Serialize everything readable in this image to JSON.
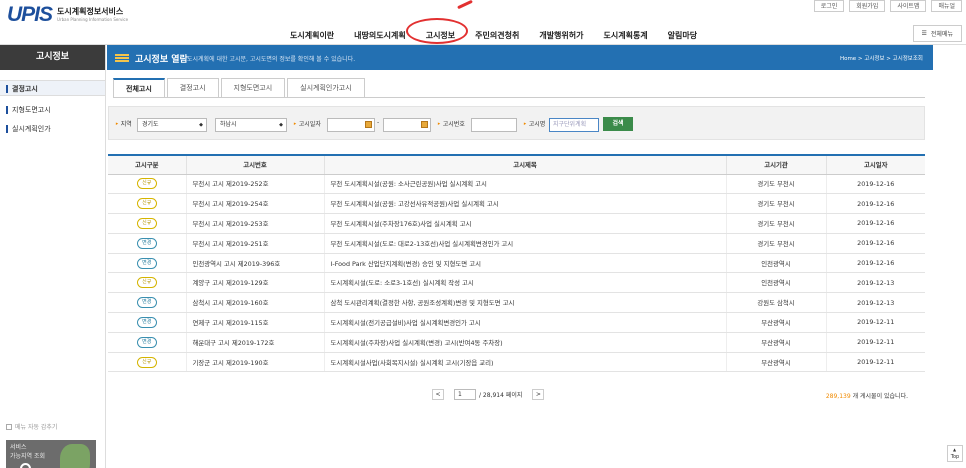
{
  "brand": {
    "logo": "UPIS",
    "name_kr": "도시계획정보서비스",
    "name_en": "Urban Planning Information Service"
  },
  "util": [
    "로그인",
    "회원가입",
    "사이트맵",
    "매뉴얼"
  ],
  "gnb": [
    "도시계획이란",
    "내땅의도시계획",
    "고시정보",
    "주민의견청취",
    "개발행위허가",
    "도시계획통계",
    "알림마당"
  ],
  "all_menu": "전체메뉴",
  "sidebar": {
    "title": "고시정보",
    "items": [
      "결정고시",
      "지형도면고시",
      "실시계획인가"
    ],
    "auto_hide": "메뉴 자동 감추기",
    "banner_line1": "서비스",
    "banner_line2": "가능지역 조회"
  },
  "header": {
    "title": "고시정보 열람",
    "desc": "도시계획에 대한 고시문, 고시도면의 정보를 확인해 볼 수 있습니다.",
    "breadcrumb": "Home > 고시정보 > 고시정보조회"
  },
  "tabs": [
    "전체고시",
    "결정고시",
    "지형도면고시",
    "실시계획인가고시"
  ],
  "filters": {
    "region_label": "지역",
    "region1": "경기도",
    "region2": "하남시",
    "date_label": "고시일자",
    "date_sep": "-",
    "number_label": "고시번호",
    "name_label": "고시명",
    "name_placeholder": "지구단위계획",
    "search": "검색"
  },
  "columns": [
    "고시구분",
    "고시번호",
    "고시제목",
    "고시기관",
    "고시일자"
  ],
  "rows": [
    {
      "type": "신규",
      "kind": "new",
      "num": "부천시 고시 제2019-252호",
      "title": "부천 도시계획시설(공원: 소사근린공원)사업 실시계획 고시",
      "org": "경기도 부천시",
      "date": "2019-12-16"
    },
    {
      "type": "신규",
      "kind": "new",
      "num": "부천시 고시 제2019-254호",
      "title": "부천 도시계획시설(공원: 고강선사유적공원)사업 실시계획 고시",
      "org": "경기도 부천시",
      "date": "2019-12-16"
    },
    {
      "type": "신규",
      "kind": "new",
      "num": "부천시 고시 제2019-253호",
      "title": "부천 도시계획시설(주차장176호)사업 실시계획 고시",
      "org": "경기도 부천시",
      "date": "2019-12-16"
    },
    {
      "type": "변경",
      "kind": "change",
      "num": "부천시 고시 제2019-251호",
      "title": "부천 도시계획시설(도로: 대로2-13호선)사업 실시계획변경인가 고시",
      "org": "경기도 부천시",
      "date": "2019-12-16"
    },
    {
      "type": "변경",
      "kind": "change",
      "num": "인천광역시 고시 제2019-396호",
      "title": "I-Food Park 산업단지계획(변경) 승인 및 지형도면 고시",
      "org": "인천광역시",
      "date": "2019-12-16"
    },
    {
      "type": "신규",
      "kind": "new",
      "num": "계양구 고시 제2019-129호",
      "title": "도시계획시설(도로: 소로3-1호선) 실시계획 작성 고시",
      "org": "인천광역시",
      "date": "2019-12-13"
    },
    {
      "type": "변경",
      "kind": "change",
      "num": "삼척시 고시 제2019-160호",
      "title": "삼척 도시관리계획(결정한 사항, 공원조성계획)변경 및 지형도면 고시",
      "org": "강원도 삼척시",
      "date": "2019-12-13"
    },
    {
      "type": "변경",
      "kind": "change",
      "num": "연제구 고시 제2019-115호",
      "title": "도시계획시설(전기공급설비)사업 실시계획변경인가 고시",
      "org": "부산광역시",
      "date": "2019-12-11"
    },
    {
      "type": "변경",
      "kind": "change",
      "num": "해운대구 고시 제2019-172호",
      "title": "도시계획시설(주차장)사업 실시계획(변경) 고시(반여4동 주차장)",
      "org": "부산광역시",
      "date": "2019-12-11"
    },
    {
      "type": "신규",
      "kind": "new",
      "num": "기장군 고시 제2019-190호",
      "title": "도시계획시설사업(사회복지시설) 실시계획 고시(기장읍 교리)",
      "org": "부산광역시",
      "date": "2019-12-11"
    }
  ],
  "pager": {
    "prev": "<",
    "page": "1",
    "total_pages": "/ 28,914 페이지",
    "next": ">"
  },
  "total": {
    "count": "289,139",
    "suffix": "개 게시물이 있습니다."
  },
  "top_button": "Top"
}
